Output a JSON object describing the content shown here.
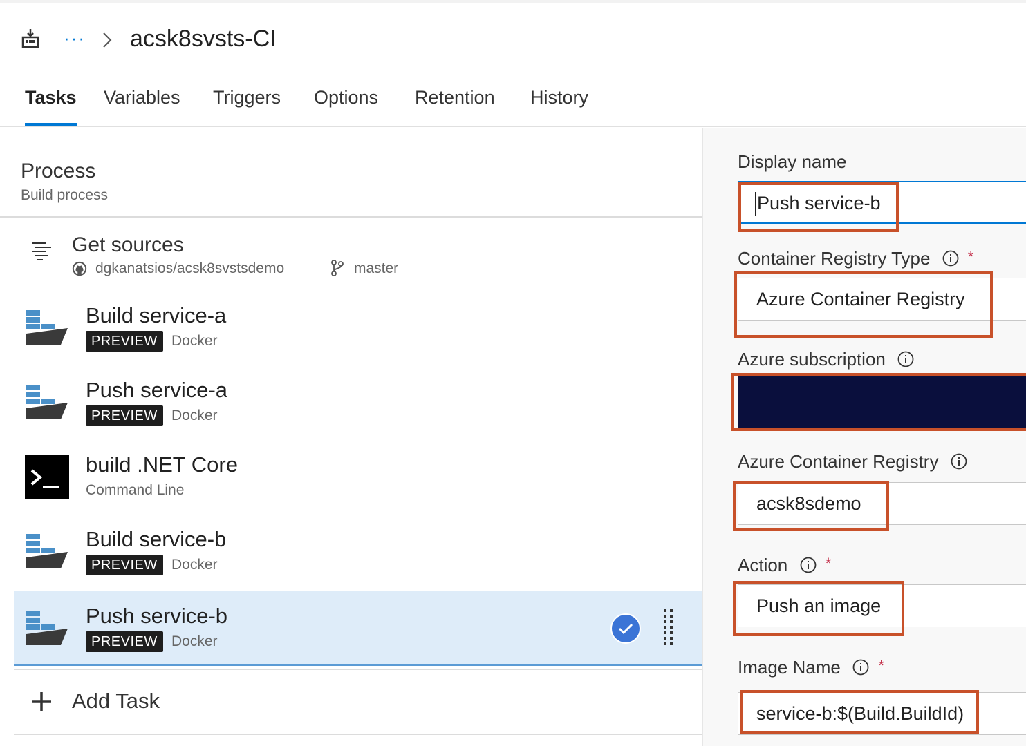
{
  "header": {
    "title": "acsk8svsts-CI",
    "more_label": "···"
  },
  "tabs": [
    {
      "label": "Tasks",
      "active": true
    },
    {
      "label": "Variables"
    },
    {
      "label": "Triggers"
    },
    {
      "label": "Options"
    },
    {
      "label": "Retention"
    },
    {
      "label": "History"
    }
  ],
  "process": {
    "title": "Process",
    "subtitle": "Build process"
  },
  "sources": {
    "title": "Get sources",
    "repo": "dgkanatsios/acsk8svstsdemo",
    "branch": "master"
  },
  "tasks": [
    {
      "title": "Build service-a",
      "badge": "PREVIEW",
      "type": "Docker",
      "icon": "docker-icon"
    },
    {
      "title": "Push service-a",
      "badge": "PREVIEW",
      "type": "Docker",
      "icon": "docker-icon"
    },
    {
      "title": "build .NET Core",
      "type": "Command Line",
      "icon": "command-line-icon"
    },
    {
      "title": "Build service-b",
      "badge": "PREVIEW",
      "type": "Docker",
      "icon": "docker-icon"
    },
    {
      "title": "Push service-b",
      "badge": "PREVIEW",
      "type": "Docker",
      "icon": "docker-icon",
      "selected": true
    }
  ],
  "add_task": {
    "label": "Add Task"
  },
  "form": {
    "display_name": {
      "label": "Display name",
      "value": "Push service-b"
    },
    "registry_type": {
      "label": "Container Registry Type",
      "required": "*",
      "value": "Azure Container Registry"
    },
    "subscription": {
      "label": "Azure subscription",
      "value": ""
    },
    "registry": {
      "label": "Azure Container Registry",
      "value": "acsk8sdemo"
    },
    "action": {
      "label": "Action",
      "required": "*",
      "value": "Push an image"
    },
    "image_name": {
      "label": "Image Name",
      "required": "*",
      "value": "service-b:$(Build.BuildId)"
    }
  },
  "colors": {
    "accent": "#0078d4",
    "highlight_box": "#c8512a",
    "selected_row": "#deecf9",
    "subscription_field": "#0a0f3d",
    "required": "#c4314b"
  }
}
